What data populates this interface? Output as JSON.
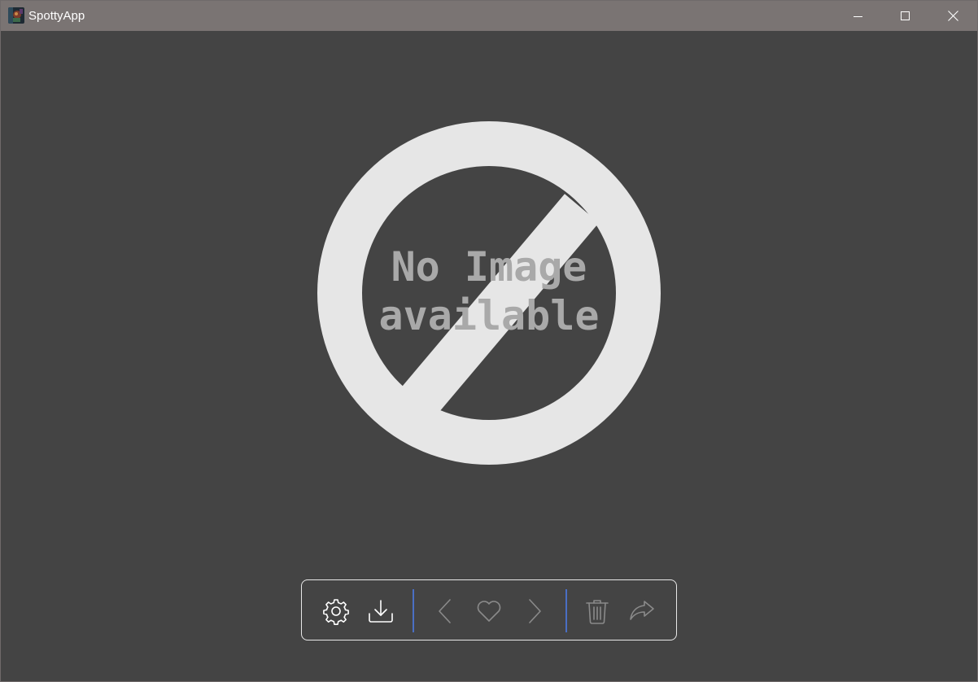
{
  "window": {
    "title": "SpottyApp",
    "app_icon": "spotty-app-icon",
    "controls": [
      "minimize-icon",
      "maximize-icon",
      "close-icon"
    ]
  },
  "main": {
    "placeholder": {
      "icon": "no-image-prohibited-icon",
      "line1": "No Image",
      "line2": "available",
      "colors": {
        "symbol": "#e6e6e6",
        "text": "#a9a9a9",
        "background": "#444444"
      }
    }
  },
  "toolbar": {
    "buttons": [
      {
        "icon": "gear-icon",
        "enabled": true
      },
      {
        "icon": "download-icon",
        "enabled": true
      },
      {
        "icon": "chevron-left-icon",
        "enabled": false
      },
      {
        "icon": "heart-icon",
        "enabled": false
      },
      {
        "icon": "chevron-right-icon",
        "enabled": false
      },
      {
        "icon": "trash-icon",
        "enabled": false
      },
      {
        "icon": "share-icon",
        "enabled": false
      }
    ],
    "separator_color": "#4a6fc4",
    "border_color": "#e8e8e8"
  },
  "colors": {
    "titlebar": "#7a7473",
    "background": "#444444"
  }
}
